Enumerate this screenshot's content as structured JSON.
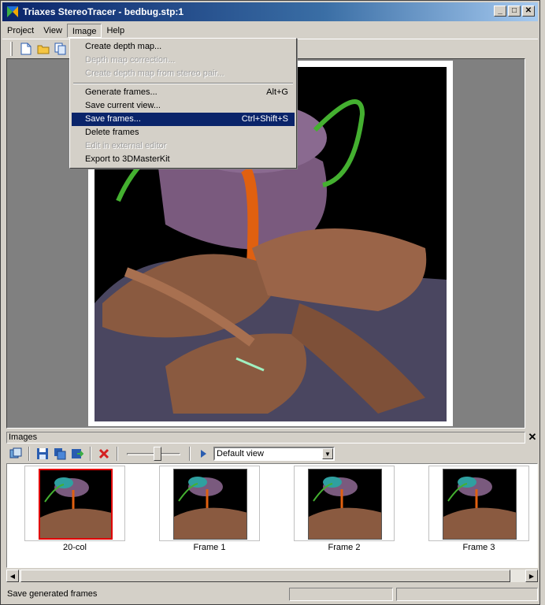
{
  "window": {
    "title": "Triaxes StereoTracer - bedbug.stp:1"
  },
  "title_buttons": {
    "minimize": "_",
    "maximize": "□",
    "close": "✕"
  },
  "menubar": [
    {
      "label": "Project"
    },
    {
      "label": "View"
    },
    {
      "label": "Image"
    },
    {
      "label": "Help"
    }
  ],
  "image_menu": {
    "items": [
      {
        "label": "Create depth map...",
        "shortcut": "",
        "state": "enabled"
      },
      {
        "label": "Depth map correction...",
        "shortcut": "",
        "state": "disabled"
      },
      {
        "label": "Create depth map from stereo pair...",
        "shortcut": "",
        "state": "disabled"
      },
      {
        "label": "Generate frames...",
        "shortcut": "Alt+G",
        "state": "enabled"
      },
      {
        "label": "Save current view...",
        "shortcut": "",
        "state": "enabled"
      },
      {
        "label": "Save frames...",
        "shortcut": "Ctrl+Shift+S",
        "state": "selected"
      },
      {
        "label": "Delete frames",
        "shortcut": "",
        "state": "enabled"
      },
      {
        "label": "Edit in external editor",
        "shortcut": "",
        "state": "disabled"
      },
      {
        "label": "Export to 3DMasterKit",
        "shortcut": "",
        "state": "enabled"
      }
    ]
  },
  "images_panel": {
    "title": "Images",
    "close_glyph": "✕",
    "view_select": "Default view",
    "slider_level": 0.58
  },
  "thumbnails": [
    {
      "label": "20-col",
      "selected": true
    },
    {
      "label": "Frame 1",
      "selected": false
    },
    {
      "label": "Frame 2",
      "selected": false
    },
    {
      "label": "Frame 3",
      "selected": false
    }
  ],
  "statusbar": {
    "text": "Save generated frames"
  },
  "icons": {
    "toolbar": [
      "new-document-icon",
      "open-folder-icon",
      "copy-document-icon"
    ],
    "images_toolbar": [
      "frames-icon",
      "save-icon",
      "save-all-icon",
      "export-icon",
      "delete-icon",
      "play-icon"
    ]
  },
  "colors": {
    "title_bar": "#0a246a",
    "menu_highlight": "#0a246a",
    "selected_thumb_border": "#e00000",
    "delete_icon": "#d42020"
  }
}
